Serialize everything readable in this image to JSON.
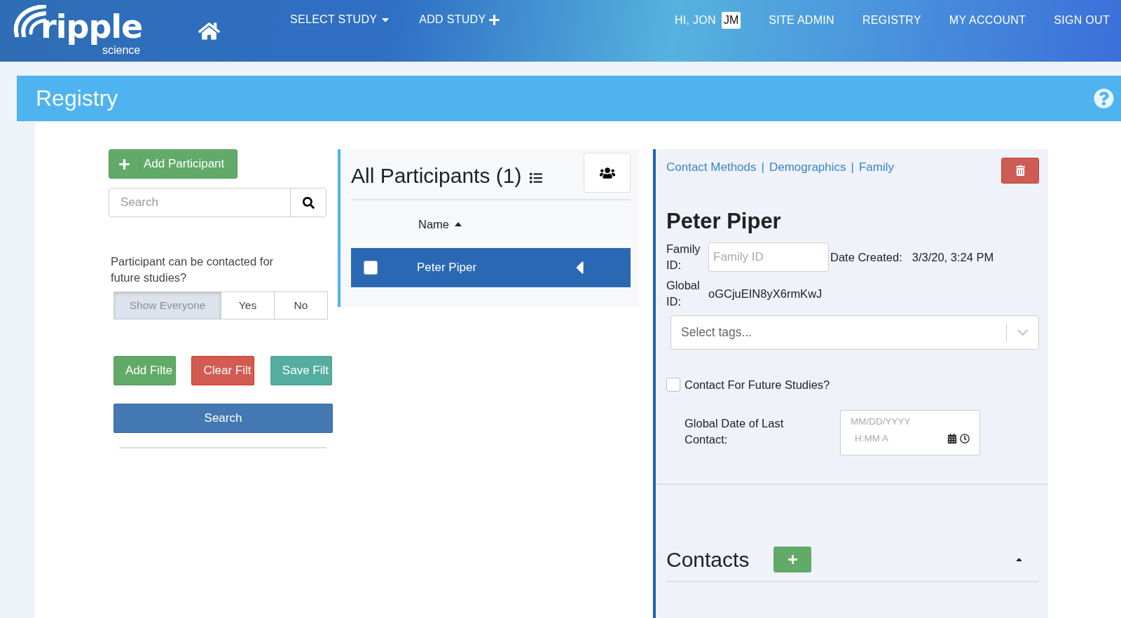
{
  "header": {
    "logo": {
      "name": "ripple",
      "tagline": "science"
    },
    "nav_left": [
      {
        "label": "SELECT STUDY",
        "kind": "dropdown"
      },
      {
        "label": "ADD STUDY",
        "kind": "add"
      }
    ],
    "greeting": "HI, JON",
    "initials": "JM",
    "nav_right": [
      "SITE ADMIN",
      "REGISTRY",
      "MY ACCOUNT",
      "SIGN OUT"
    ]
  },
  "page_title": "Registry",
  "filters": {
    "add_button": "Add Participant",
    "search": {
      "placeholder": "Search"
    },
    "question": "Participant can be contacted for future studies?",
    "options": [
      {
        "label": "Show Everyone",
        "selected": true
      },
      {
        "label": "Yes",
        "selected": false
      },
      {
        "label": "No",
        "selected": false
      }
    ],
    "actions": [
      {
        "label": "Add Filte",
        "kind": "add"
      },
      {
        "label": "Clear Filt",
        "kind": "clear"
      },
      {
        "label": "Save Filt",
        "kind": "save"
      }
    ],
    "search_button": "Search"
  },
  "participants": {
    "title": "All Participants (1)",
    "column": "Name",
    "rows": [
      {
        "name": "Peter Piper",
        "checked": false,
        "selected": true
      }
    ]
  },
  "detail": {
    "links": [
      "Contact Methods",
      "Demographics",
      "Family"
    ],
    "link_separator": "|",
    "name": "Peter Piper",
    "family_id_label": "Family ID:",
    "family_id": {
      "placeholder": "Family ID"
    },
    "date_created_label": "Date Created:",
    "date_created": "3/3/20, 3:24 PM",
    "global_id_label": "Global ID:",
    "global_id": "oGCjuEIN8yX6rmKwJ",
    "tags": {
      "placeholder": "Select tags..."
    },
    "contact_future": {
      "label": "Contact For Future Studies?",
      "checked": false
    },
    "last_contact_label": "Global Date of Last Contact:",
    "date_placeholder": "MM/DD/YYYY",
    "time_placeholder": "H:MM A",
    "contacts_title": "Contacts",
    "contacts_expanded": true
  }
}
